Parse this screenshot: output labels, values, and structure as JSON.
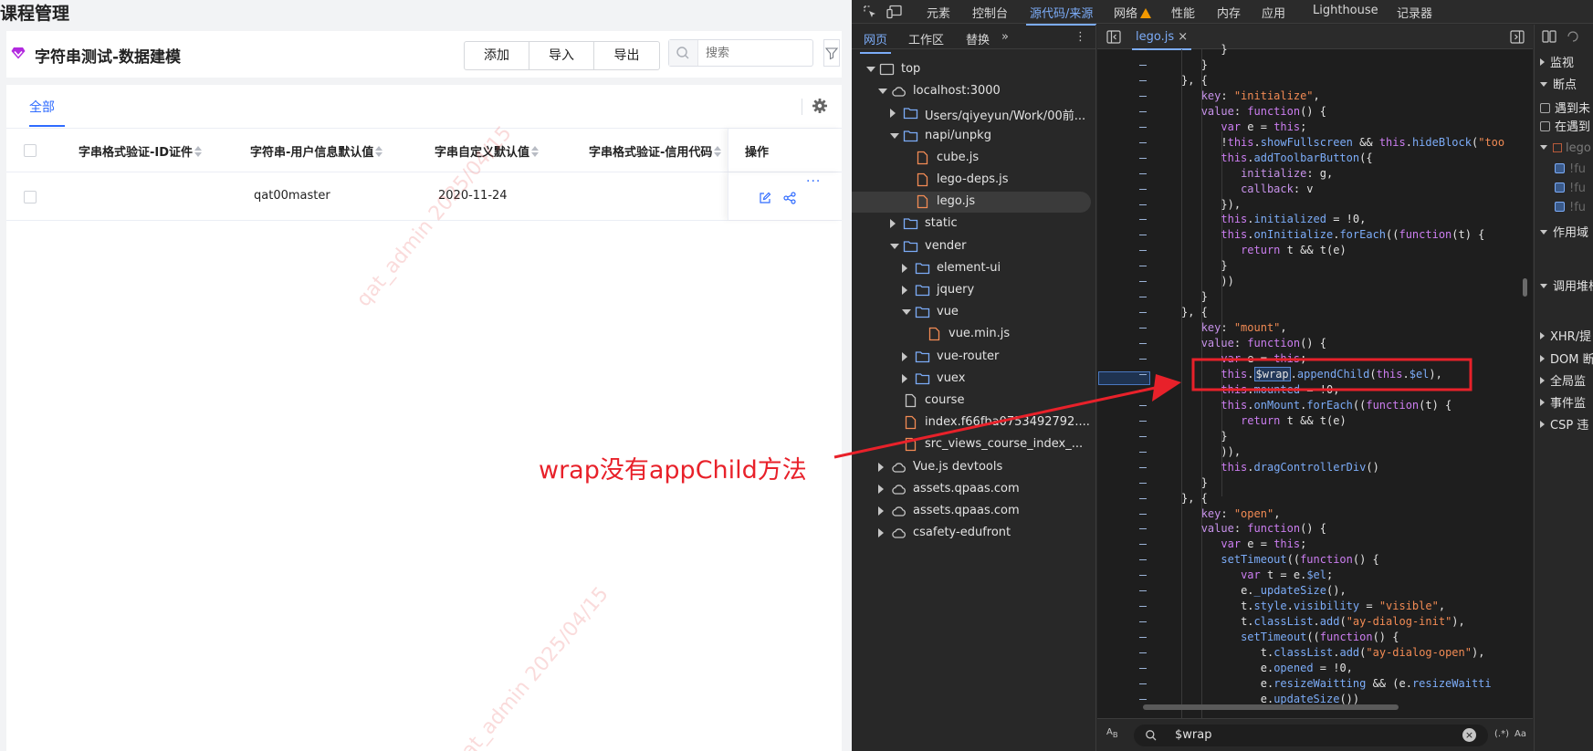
{
  "app": {
    "page_title": "课程管理",
    "model_name": "字符串测试-数据建模",
    "actions": {
      "add": "添加",
      "import": "导入",
      "export": "导出"
    },
    "search": {
      "placeholder": "搜索"
    },
    "tabs": {
      "all": "全部"
    },
    "columns": [
      "字串格式验证-ID证件",
      "字符串-用户信息默认值",
      "字串自定义默认值",
      "字串格式验证-信用代码",
      "操作"
    ],
    "row": {
      "user_info_default": "qat00master",
      "custom_default": "2020-11-24"
    },
    "watermark": "qat_admin 2025/04/15",
    "accent_color": "#2f6bff"
  },
  "annotation": {
    "text": "wrap没有appChild方法",
    "color": "#e8212a"
  },
  "devtools": {
    "top_tabs": [
      "元素",
      "控制台",
      "源代码/来源",
      "网络",
      "性能",
      "内存",
      "应用",
      "Lighthouse",
      "记录器"
    ],
    "active_top_tab": "源代码/来源",
    "nav_tabs": [
      "网页",
      "工作区",
      "替换"
    ],
    "active_nav_tab": "网页",
    "file_tree": [
      {
        "label": "top",
        "icon": "frame-icon"
      },
      {
        "label": "localhost:3000",
        "icon": "cloud-icon"
      },
      {
        "label": "Users/qiyeyun/Work/00前...",
        "icon": "folder-icon"
      },
      {
        "label": "napi/unpkg",
        "icon": "folder-icon"
      },
      {
        "label": "cube.js",
        "icon": "js-file-icon"
      },
      {
        "label": "lego-deps.js",
        "icon": "js-file-icon"
      },
      {
        "label": "lego.js",
        "icon": "js-file-icon",
        "selected": true
      },
      {
        "label": "static",
        "icon": "folder-icon"
      },
      {
        "label": "vender",
        "icon": "folder-icon"
      },
      {
        "label": "element-ui",
        "icon": "folder-icon"
      },
      {
        "label": "jquery",
        "icon": "folder-icon"
      },
      {
        "label": "vue",
        "icon": "folder-icon"
      },
      {
        "label": "vue.min.js",
        "icon": "js-file-icon"
      },
      {
        "label": "vue-router",
        "icon": "folder-icon"
      },
      {
        "label": "vuex",
        "icon": "folder-icon"
      },
      {
        "label": "course",
        "icon": "doc-file-icon"
      },
      {
        "label": "index.f66fba0753492792....",
        "icon": "js-file-icon"
      },
      {
        "label": "src_views_course_index_...",
        "icon": "js-file-icon"
      },
      {
        "label": "Vue.js devtools",
        "icon": "cloud-icon"
      },
      {
        "label": "assets.qpaas.com",
        "icon": "cloud-icon"
      },
      {
        "label": "assets.qpaas.com",
        "icon": "cloud-icon"
      },
      {
        "label": "csafety-edufront",
        "icon": "cloud-icon"
      }
    ],
    "open_file": "lego.js",
    "search_query": "$wrap",
    "side_panel": {
      "watch": "监视",
      "breakpoints": "断点",
      "cb1": "遇到未",
      "cb2": "在遇到",
      "bp_file": "lego",
      "bp1": "!fu",
      "bp2": "!fu",
      "bp3": "!fu",
      "scope": "作用域",
      "call_stack": "调用堆栈",
      "xhr": "XHR/提",
      "dom": "DOM 断",
      "global": "全局监",
      "event": "事件监",
      "csp": "CSP 违"
    }
  }
}
